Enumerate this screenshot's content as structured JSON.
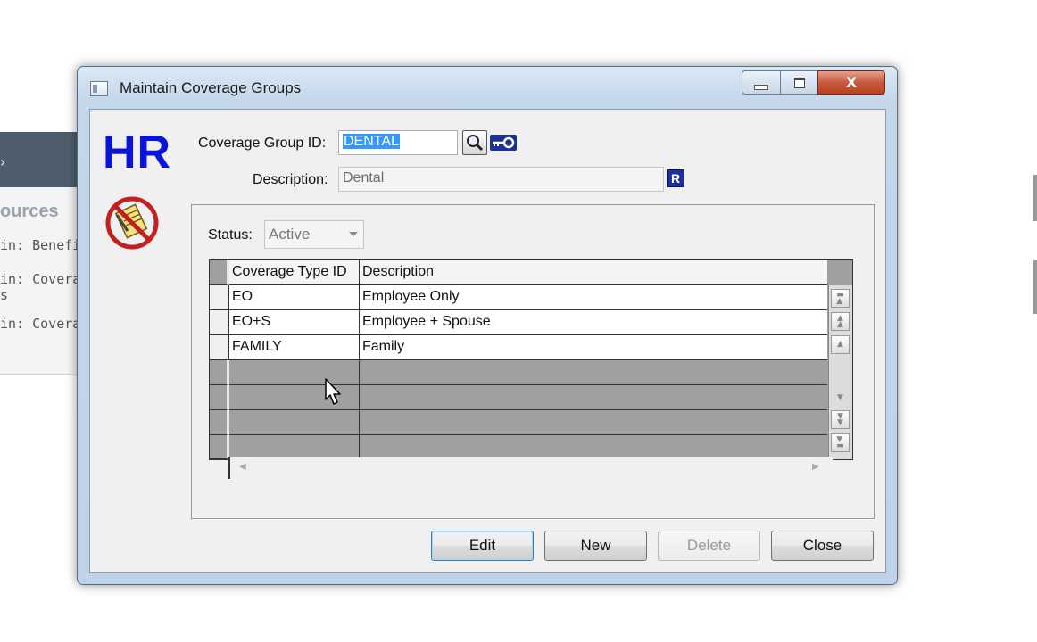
{
  "background": {
    "section_title": "ources",
    "links": [
      "in: Benefi",
      "in: Covera",
      "s",
      "in: Covera"
    ]
  },
  "window": {
    "title": "Maintain Coverage Groups",
    "close_glyph": "X"
  },
  "branding": {
    "logo_text": "HR"
  },
  "form": {
    "coverage_group_id_label": "Coverage Group ID:",
    "coverage_group_id_value": "DENTAL",
    "description_label": "Description:",
    "description_value": "Dental",
    "required_badge": "R",
    "status_label": "Status:",
    "status_value": "Active"
  },
  "grid": {
    "columns": [
      "Coverage Type ID",
      "Description"
    ],
    "rows": [
      {
        "type_id": "EO",
        "description": "Employee Only"
      },
      {
        "type_id": "EO+S",
        "description": "Employee + Spouse"
      },
      {
        "type_id": "FAMILY",
        "description": "Family"
      }
    ]
  },
  "buttons": {
    "edit": "Edit",
    "new": "New",
    "delete": "Delete",
    "close": "Close"
  },
  "colors": {
    "logo_blue": "#0a14d8",
    "selection_blue": "#3399ff",
    "grid_empty": "#a0a0a0",
    "close_red": "#c85a40"
  }
}
